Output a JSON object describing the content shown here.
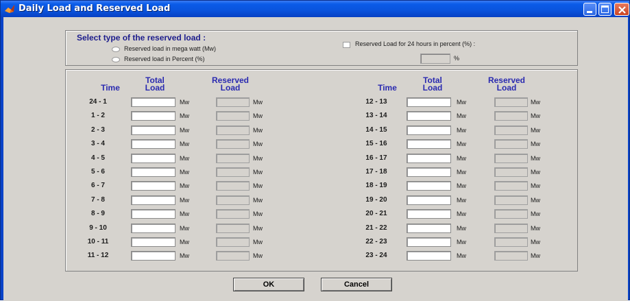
{
  "window": {
    "title": "Daily Load and Reserved Load"
  },
  "select": {
    "title": "Select type of the reserved load :",
    "option_mw": "Reserved load in mega watt (Mw)",
    "option_percent": "Reserved load in Percent (%)",
    "checkbox_label": "Reserved Load for 24 hours in percent (%) :",
    "percent_value": "",
    "percent_unit": "%"
  },
  "table": {
    "time_header": "Time",
    "total_header_1": "Total",
    "total_header_2": "Load",
    "reserved_header_1": "Reserved",
    "reserved_header_2": "Load",
    "unit": "Mw",
    "left_rows": [
      "24 - 1",
      "1 - 2",
      "2 - 3",
      "3 - 4",
      "4 - 5",
      "5 - 6",
      "6 - 7",
      "7 - 8",
      "8 - 9",
      "9 - 10",
      "10 - 11",
      "11 - 12"
    ],
    "right_rows": [
      "12 - 13",
      "13 - 14",
      "14 - 15",
      "15 - 16",
      "16 - 17",
      "17 - 18",
      "18 - 19",
      "19 - 20",
      "20 - 21",
      "21 - 22",
      "22 - 23",
      "23 - 24"
    ]
  },
  "buttons": {
    "ok": "OK",
    "cancel": "Cancel"
  },
  "colors": {
    "titlebar": "#0a53dc",
    "panel": "#d6d3ce",
    "header_text": "#2a2ab0"
  }
}
